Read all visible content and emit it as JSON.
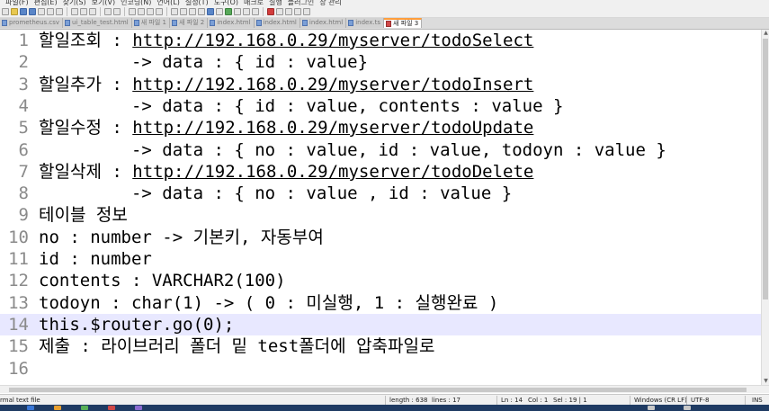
{
  "menu": [
    "파일(F)",
    "편집(E)",
    "찾기(S)",
    "보기(V)",
    "인코딩(N)",
    "언어(L)",
    "설정(T)",
    "도구(O)",
    "매크로",
    "실행",
    "플러그인",
    "창 관리"
  ],
  "tabs": [
    {
      "label": "prometheus.csv",
      "active": false
    },
    {
      "label": "ui_table_test.html",
      "active": false
    },
    {
      "label": "새 파일 1",
      "active": false
    },
    {
      "label": "새 파일 2",
      "active": false
    },
    {
      "label": "index.html",
      "active": false
    },
    {
      "label": "index.html",
      "active": false
    },
    {
      "label": "index.html",
      "active": false
    },
    {
      "label": "index.ts",
      "active": false
    },
    {
      "label": "새 파일 3",
      "active": true
    }
  ],
  "editor": {
    "current_line": 14,
    "lines": [
      {
        "num": "1",
        "pre": "할일조회 : ",
        "link": "http://192.168.0.29/myserver/todoSelect",
        "post": ""
      },
      {
        "num": "2",
        "pre": "         -> data : { id : value}",
        "link": "",
        "post": ""
      },
      {
        "num": "3",
        "pre": "할일추가 : ",
        "link": "http://192.168.0.29/myserver/todoInsert",
        "post": ""
      },
      {
        "num": "4",
        "pre": "         -> data : { id : value, contents : value }",
        "link": "",
        "post": ""
      },
      {
        "num": "5",
        "pre": "할일수정 : ",
        "link": "http://192.168.0.29/myserver/todoUpdate",
        "post": ""
      },
      {
        "num": "6",
        "pre": "         -> data : { no : value, id : value, todoyn : value }",
        "link": "",
        "post": ""
      },
      {
        "num": "7",
        "pre": "할일삭제 : ",
        "link": "http://192.168.0.29/myserver/todoDelete",
        "post": ""
      },
      {
        "num": "8",
        "pre": "         -> data : { no : value , id : value }",
        "link": "",
        "post": ""
      },
      {
        "num": "9",
        "pre": "테이블 정보",
        "link": "",
        "post": ""
      },
      {
        "num": "10",
        "pre": "no : number -> 기본키, 자동부여",
        "link": "",
        "post": ""
      },
      {
        "num": "11",
        "pre": "id : number",
        "link": "",
        "post": ""
      },
      {
        "num": "12",
        "pre": "contents : VARCHAR2(100)",
        "link": "",
        "post": ""
      },
      {
        "num": "13",
        "pre": "todoyn : char(1) -> ( 0 : 미실행, 1 : 실행완료 )",
        "link": "",
        "post": ""
      },
      {
        "num": "14",
        "pre": "this.$router.go(0);",
        "link": "",
        "post": ""
      },
      {
        "num": "15",
        "pre": "제출 : 라이브러리 폴더 밑 test폴더에 압축파일로",
        "link": "",
        "post": ""
      },
      {
        "num": "16",
        "pre": "",
        "link": "",
        "post": ""
      }
    ]
  },
  "status": {
    "file_type": "rmal text file",
    "length": "length : 638",
    "lines": "lines : 17",
    "ln": "Ln : 14",
    "col": "Col : 1",
    "sel": "Sel : 19 | 1",
    "eol": "Windows (CR LF)",
    "encoding": "UTF-8",
    "mode": "INS"
  }
}
